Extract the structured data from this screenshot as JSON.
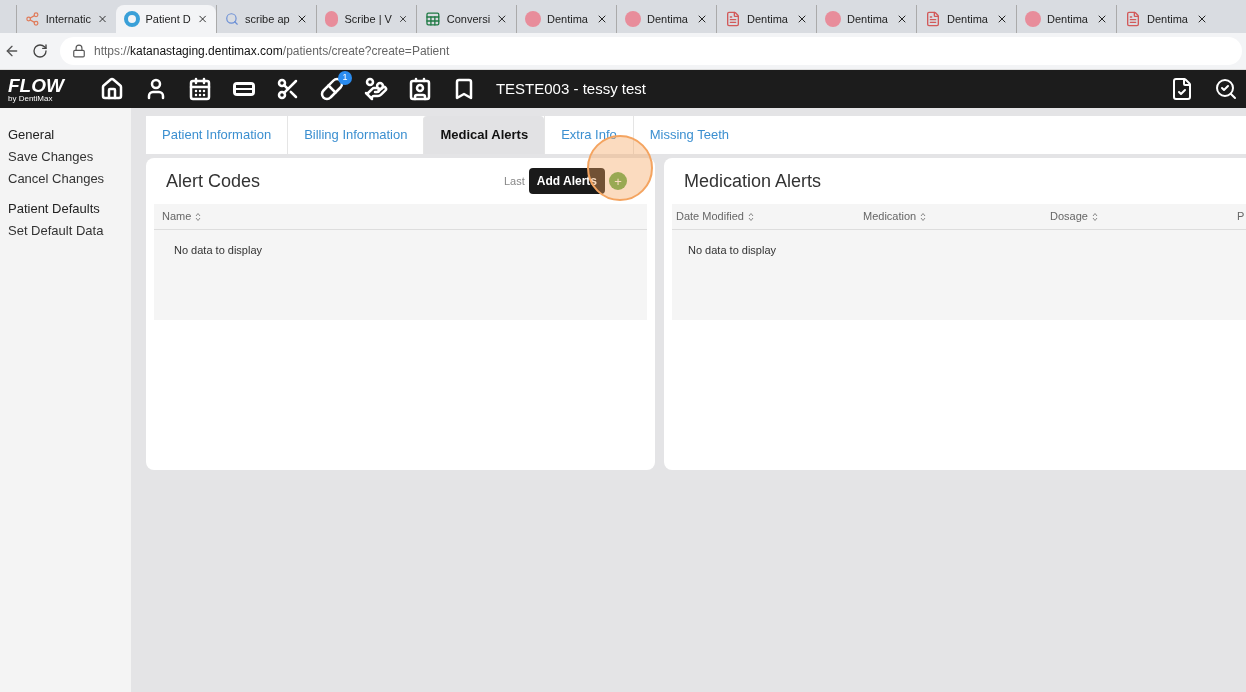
{
  "browser": {
    "tabs": [
      {
        "label": "Internatic",
        "selected": false,
        "kind": "hub"
      },
      {
        "label": "Patient D",
        "selected": true,
        "kind": "ring"
      },
      {
        "label": "scribe ap",
        "selected": false,
        "kind": "search"
      },
      {
        "label": "Scribe | V",
        "selected": false,
        "kind": "scribe"
      },
      {
        "label": "Conversi",
        "selected": false,
        "kind": "sheet"
      },
      {
        "label": "Dentima",
        "selected": false,
        "kind": "scribe"
      },
      {
        "label": "Dentima",
        "selected": false,
        "kind": "scribe"
      },
      {
        "label": "Dentima",
        "selected": false,
        "kind": "pdf"
      },
      {
        "label": "Dentima",
        "selected": false,
        "kind": "scribe"
      },
      {
        "label": "Dentima",
        "selected": false,
        "kind": "pdf"
      },
      {
        "label": "Dentima",
        "selected": false,
        "kind": "scribe"
      },
      {
        "label": "Dentima",
        "selected": false,
        "kind": "pdf"
      }
    ],
    "url_host": "katanastaging.dentimax.com",
    "url_scheme": "https://",
    "url_path": "/patients/create?create=Patient"
  },
  "app_header": {
    "logo": "FLOW",
    "logo_sub": "by DentiMax",
    "badge": "1",
    "patient": "TESTE003 - tessy test"
  },
  "sidebar": {
    "items": [
      {
        "label": "General",
        "kind": "heading"
      },
      {
        "label": "Save Changes",
        "kind": "link"
      },
      {
        "label": "Cancel Changes",
        "kind": "link"
      },
      {
        "label": "Patient Defaults",
        "kind": "heading"
      },
      {
        "label": "Set Default Data",
        "kind": "link"
      }
    ]
  },
  "tabs": [
    {
      "label": "Patient Information",
      "selected": false
    },
    {
      "label": "Billing Information",
      "selected": false
    },
    {
      "label": "Medical Alerts",
      "selected": true
    },
    {
      "label": "Extra Info",
      "selected": false
    },
    {
      "label": "Missing Teeth",
      "selected": false
    }
  ],
  "alert_codes": {
    "title": "Alert Codes",
    "last_label": "Last",
    "tooltip": "Add Alerts",
    "add_button": "+",
    "columns": [
      "Name"
    ],
    "empty": "No data to display"
  },
  "medication_alerts": {
    "title": "Medication Alerts",
    "columns": [
      "Date Modified",
      "Medication",
      "Dosage",
      "P"
    ],
    "empty": "No data to display"
  }
}
